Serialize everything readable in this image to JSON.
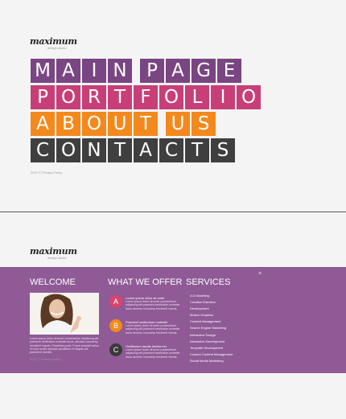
{
  "logo": {
    "name": "maximum",
    "tagline": "design studio"
  },
  "menu": [
    {
      "label": "MAIN PAGE",
      "color": "#7a4583"
    },
    {
      "label": "PORTFOLIO",
      "color": "#c83f77"
    },
    {
      "label": "ABOUT US",
      "color": "#f3891c"
    },
    {
      "label": "CONTACTS",
      "color": "#3f3f3f"
    }
  ],
  "copyright": "2012 © Privacy Policy",
  "panel": {
    "background": "#8f5a96",
    "close_label": "×",
    "welcome": {
      "title": "WELCOME",
      "text": "Lorem ipsum dolor sit amet consectetuer adipiscing elit praesent vestibulum molestie lacus. Aenean nonummy hendrerit mauris. Phasellus porta. Fusce suscipit varius mi cum sociis natoque penatibus et magnis dis parturient montes."
    },
    "offer": {
      "title": "WHAT WE OFFER",
      "items": [
        {
          "badge": "A",
          "title": "Lorem ipsum dolor sit amet",
          "text": "Lorem ipsum dolor sit amet consectetuer adipiscing elit praesent vestibulum molestie lacus aenean nonummy hendrerit mauris."
        },
        {
          "badge": "B",
          "title": "Praesent vestibulum molestie",
          "text": "Lorem ipsum dolor sit amet consectetuer adipiscing elit praesent vestibulum molestie lacus aenean nonummy hendrerit mauris."
        },
        {
          "badge": "C",
          "title": "Vestibulum iaculis lacinia est",
          "text": "Lorem ipsum dolor sit amet consectetuer adipiscing elit praesent vestibulum molestie lacus aenean nonummy hendrerit mauris."
        }
      ]
    },
    "services": {
      "title": "SERVICES",
      "items": [
        "3-D Modeling",
        "Creative Direction",
        "Development",
        "Motion Graphics",
        "Content Management",
        "Search Engine Marketing",
        "Interactive Design",
        "Interactive Development",
        "Template Development",
        "Custom Content Management",
        "Social Media Marketing"
      ]
    }
  }
}
